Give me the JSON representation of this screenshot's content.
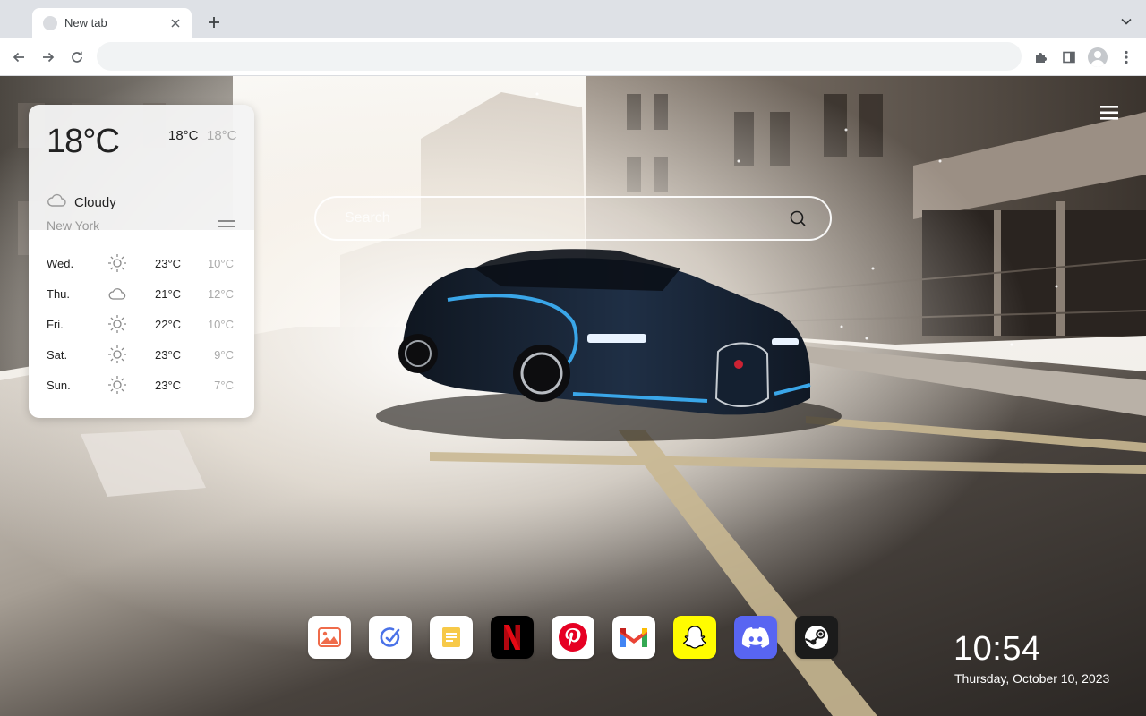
{
  "browser": {
    "tab": {
      "title": "New tab"
    },
    "omnibox": {
      "value": "",
      "placeholder": ""
    }
  },
  "search": {
    "placeholder": "Search"
  },
  "weather": {
    "temperature": "18°C",
    "high": "18°C",
    "low": "18°C",
    "condition": "Cloudy",
    "condition_icon": "cloud-icon",
    "city": "New York",
    "forecast": [
      {
        "day": "Wed.",
        "icon": "sun-icon",
        "high": "23°C",
        "low": "10°C"
      },
      {
        "day": "Thu.",
        "icon": "cloud-icon",
        "high": "21°C",
        "low": "12°C"
      },
      {
        "day": "Fri.",
        "icon": "sun-icon",
        "high": "22°C",
        "low": "10°C"
      },
      {
        "day": "Sat.",
        "icon": "sun-icon",
        "high": "23°C",
        "low": "9°C"
      },
      {
        "day": "Sun.",
        "icon": "sun-icon",
        "high": "23°C",
        "low": "7°C"
      }
    ]
  },
  "dock": {
    "apps": [
      {
        "name": "photos",
        "icon": "photo-icon",
        "color": "#ffffff"
      },
      {
        "name": "tasks",
        "icon": "task-check-icon",
        "color": "#ffffff"
      },
      {
        "name": "notes",
        "icon": "notes-icon",
        "color": "#ffffff"
      },
      {
        "name": "netflix",
        "icon": "netflix-icon",
        "color": "#000000"
      },
      {
        "name": "pinterest",
        "icon": "pinterest-icon",
        "color": "#ffffff"
      },
      {
        "name": "gmail",
        "icon": "gmail-icon",
        "color": "#ffffff"
      },
      {
        "name": "snapchat",
        "icon": "snapchat-icon",
        "color": "#fffc00"
      },
      {
        "name": "discord",
        "icon": "discord-icon",
        "color": "#5865f2"
      },
      {
        "name": "steam",
        "icon": "steam-icon",
        "color": "#1b1b1b"
      }
    ]
  },
  "clock": {
    "time": "10:54",
    "date": "Thursday, October 10, 2023"
  }
}
